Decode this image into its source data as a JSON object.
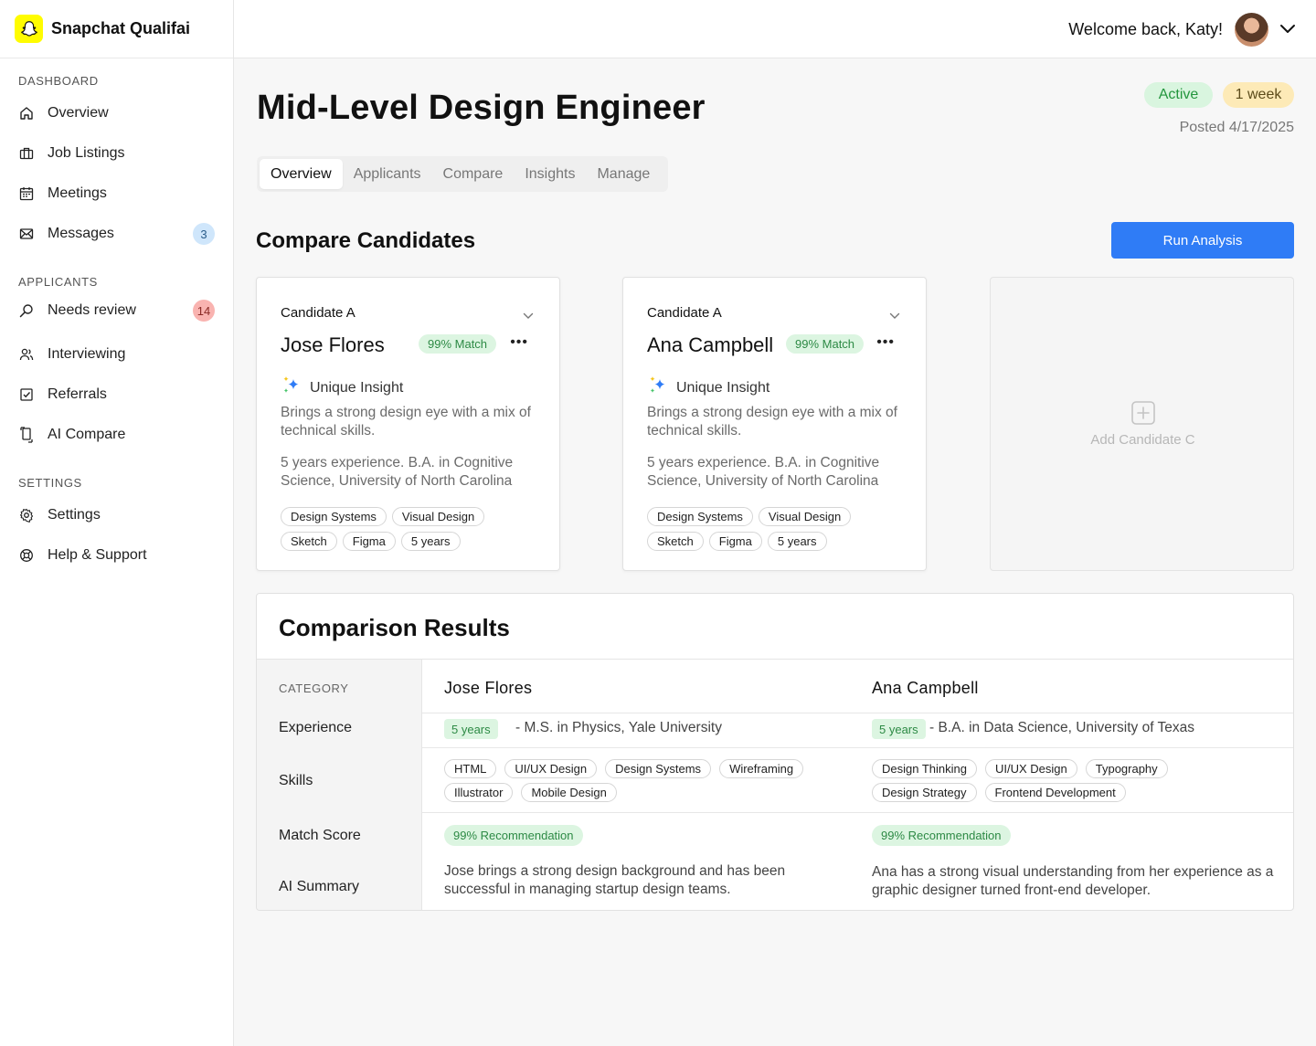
{
  "app": {
    "name": "Snapchat Qualifai",
    "brand_color": "#FFFC00"
  },
  "sidebar": {
    "sections": [
      {
        "label": "DASHBOARD"
      },
      {
        "label": "APPLICANTS"
      },
      {
        "label": "SETTINGS"
      }
    ],
    "items": [
      {
        "label": "Overview",
        "icon": "home-icon"
      },
      {
        "label": "Job Listings",
        "icon": "briefcase-icon"
      },
      {
        "label": "Meetings",
        "icon": "calendar-icon"
      },
      {
        "label": "Messages",
        "icon": "mail-icon",
        "badge": "3"
      },
      {
        "label": "Needs review",
        "icon": "search-icon",
        "badge": "14"
      },
      {
        "label": "Interviewing",
        "icon": "users-icon"
      },
      {
        "label": "Referrals",
        "icon": "checkbox-icon"
      },
      {
        "label": "AI Compare",
        "icon": "compare-icon"
      },
      {
        "label": "Settings",
        "icon": "gear-icon"
      },
      {
        "label": "Help & Support",
        "icon": "lifebuoy-icon"
      }
    ]
  },
  "header": {
    "welcome": "Welcome back, Katy!"
  },
  "job": {
    "title": "Mid-Level Design Engineer",
    "status": "Active",
    "duration": "1 week",
    "posted": "Posted 4/17/2025"
  },
  "tabs": [
    "Overview",
    "Applicants",
    "Compare",
    "Insights",
    "Manage"
  ],
  "compare": {
    "title": "Compare Candidates",
    "run_button": "Run Analysis",
    "add_label": "Add Candidate C",
    "candidates": [
      {
        "slot": "Candidate A",
        "name": "Jose Flores",
        "match": "99% Match",
        "insight_title": "Unique Insight",
        "insight": "Brings a strong design eye with a mix of technical skills.",
        "background": "5 years experience. B.A. in Cognitive Science, University of North Carolina",
        "tags": [
          "Design Systems",
          "Visual Design",
          "Sketch",
          "Figma",
          "5 years"
        ]
      },
      {
        "slot": "Candidate A",
        "name": "Ana Campbell",
        "match": "99% Match",
        "insight_title": "Unique Insight",
        "insight": "Brings a strong design eye with a mix of technical skills.",
        "background": "5 years experience. B.A. in Cognitive Science, University of North Carolina",
        "tags": [
          "Design Systems",
          "Visual Design",
          "Sketch",
          "Figma",
          "5 years"
        ]
      }
    ]
  },
  "results": {
    "title": "Comparison Results",
    "category_header": "CATEGORY",
    "categories": [
      "Experience",
      "Skills",
      "Match Score",
      "AI Summary"
    ],
    "columns": [
      {
        "name": "Jose Flores",
        "years": "5 years",
        "education": "- M.S. in Physics, Yale University",
        "skills": [
          "HTML",
          "UI/UX Design",
          "Design Systems",
          "Wireframing",
          "Illustrator",
          "Mobile Design"
        ],
        "recommendation": "99% Recommendation",
        "summary": "Jose brings a strong design background and has been successful in managing startup design teams."
      },
      {
        "name": "Ana Campbell",
        "years": "5 years",
        "education": "- B.A. in Data Science, University of Texas",
        "skills": [
          "Design Thinking",
          "UI/UX Design",
          "Typography",
          "Design Strategy",
          "Frontend Development"
        ],
        "recommendation": "99% Recommendation",
        "summary": "Ana has a strong visual understanding from her experience as a graphic designer turned front-end developer."
      }
    ]
  },
  "colors": {
    "primary": "#2f7cf6",
    "success_bg": "#dcf5e1",
    "success_text": "#2d8a45",
    "warning_bg": "#fdeab7"
  }
}
